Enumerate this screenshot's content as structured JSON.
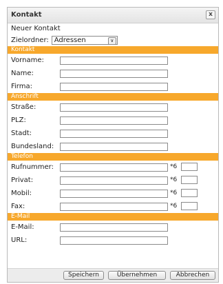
{
  "dialog": {
    "title": "Kontakt",
    "close_label": "x",
    "subtitle": "Neuer Kontakt",
    "folder_label": "Zielordner:",
    "folder_value": "Adressen",
    "folder_arrow": "∨"
  },
  "sections": {
    "kontakt": {
      "header": "Kontakt",
      "vorname": "Vorname:",
      "name": "Name:",
      "firma": "Firma:"
    },
    "anschrift": {
      "header": "Anschrift",
      "strasse": "Straße:",
      "plz": "PLZ:",
      "stadt": "Stadt:",
      "bundesland": "Bundesland:"
    },
    "telefon": {
      "header": "Telefon",
      "rufnummer": "Rufnummer:",
      "privat": "Privat:",
      "mobil": "Mobil:",
      "fax": "Fax:",
      "prefix": "*6"
    },
    "email": {
      "header": "E-Mail",
      "email": "E-Mail:",
      "url": "URL:"
    }
  },
  "buttons": {
    "save": "Speichern",
    "apply": "Übernehmen",
    "cancel": "Abbrechen"
  },
  "colors": {
    "section_header": "#f7a82c"
  }
}
